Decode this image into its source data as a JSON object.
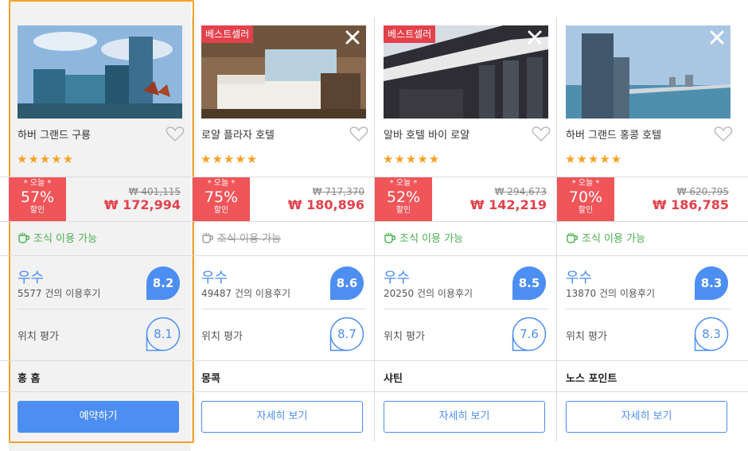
{
  "hotels": [
    {
      "name": "하버 그랜드 구룡",
      "badge": "",
      "stars": "★★★★★",
      "discount": {
        "today": "* 오늘 *",
        "percent": "57%",
        "off": "할인"
      },
      "original_price": "₩ 401,115",
      "price": "₩ 172,994",
      "breakfast": "조식 이용 가능",
      "breakfast_available": true,
      "rating_label": "우수",
      "review_count": "5577 건의 이용후기",
      "score": "8.2",
      "location_label": "위치 평가",
      "location_score": "8.1",
      "area": "홍 홈",
      "button": "예약하기",
      "selected": true
    },
    {
      "name": "로얄 플라자 호텔",
      "badge": "베스트셀러",
      "stars": "★★★★★",
      "discount": {
        "today": "* 오늘 *",
        "percent": "75%",
        "off": "할인"
      },
      "original_price": "₩ 717,370",
      "price": "₩ 180,896",
      "breakfast": "조식 이용 가능",
      "breakfast_available": false,
      "rating_label": "우수",
      "review_count": "49487 건의 이용후기",
      "score": "8.6",
      "location_label": "위치 평가",
      "location_score": "8.7",
      "area": "몽콕",
      "button": "자세히 보기",
      "selected": false
    },
    {
      "name": "알바 호텔 바이 로얄",
      "badge": "베스트셀러",
      "stars": "★★★★★",
      "discount": {
        "today": "* 오늘 *",
        "percent": "52%",
        "off": "할인"
      },
      "original_price": "₩ 294,673",
      "price": "₩ 142,219",
      "breakfast": "조식 이용 가능",
      "breakfast_available": true,
      "rating_label": "우수",
      "review_count": "20250 건의 이용후기",
      "score": "8.5",
      "location_label": "위치 평가",
      "location_score": "7.6",
      "area": "샤틴",
      "button": "자세히 보기",
      "selected": false
    },
    {
      "name": "하버 그랜드 홍콩 호텔",
      "badge": "",
      "stars": "★★★★★",
      "discount": {
        "today": "* 오늘 *",
        "percent": "70%",
        "off": "할인"
      },
      "original_price": "₩ 620,795",
      "price": "₩ 186,785",
      "breakfast": "조식 이용 가능",
      "breakfast_available": true,
      "rating_label": "우수",
      "review_count": "13870 건의 이용후기",
      "score": "8.3",
      "location_label": "위치 평가",
      "location_score": "8.3",
      "area": "노스 포인트",
      "button": "자세히 보기",
      "selected": false
    }
  ],
  "colors": {
    "accent": "#4d8ef2",
    "discount": "#ef5559",
    "price": "#e3414b",
    "star": "#f7a123",
    "breakfast": "#4caf50",
    "selected_border": "#f7a123"
  }
}
